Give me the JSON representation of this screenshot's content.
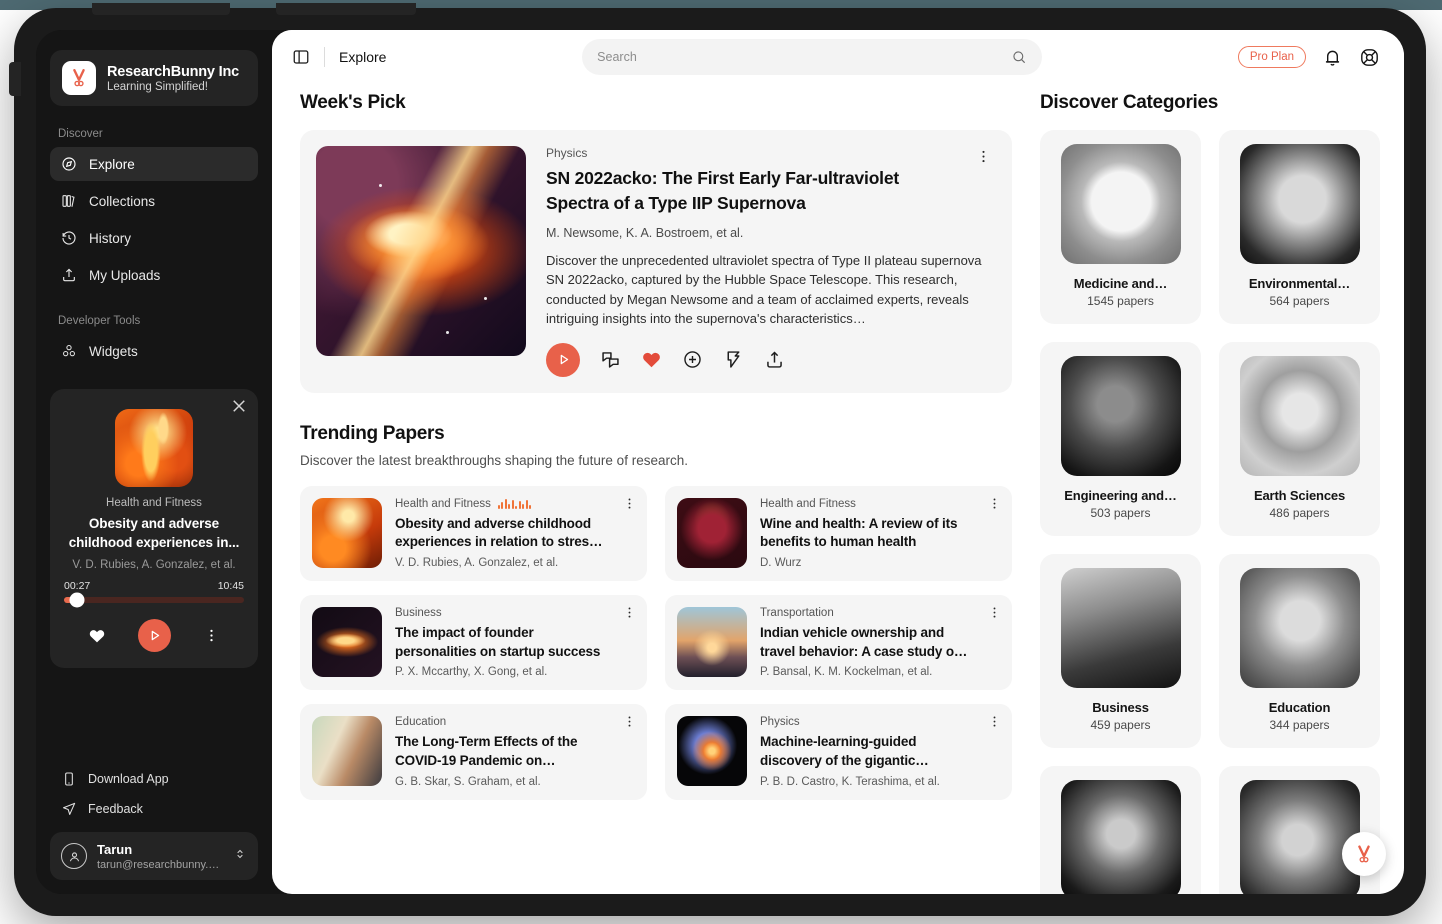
{
  "brand": {
    "name": "ResearchBunny Inc",
    "tagline": "Learning Simplified!",
    "logo_icon": "bunny-logo-icon"
  },
  "sidebar": {
    "groups": [
      {
        "label": "Discover",
        "items": [
          {
            "label": "Explore",
            "icon": "compass-icon",
            "active": true
          },
          {
            "label": "Collections",
            "icon": "books-icon",
            "active": false
          },
          {
            "label": "History",
            "icon": "history-clock-icon",
            "active": false
          },
          {
            "label": "My Uploads",
            "icon": "upload-icon",
            "active": false
          }
        ]
      },
      {
        "label": "Developer Tools",
        "items": [
          {
            "label": "Widgets",
            "icon": "widgets-icon",
            "active": false
          }
        ]
      }
    ],
    "player": {
      "category": "Health and Fitness",
      "title": "Obesity and adverse childhood experiences in...",
      "authors": "V. D. Rubies, A. Gonzalez, et al.",
      "current_time": "00:27",
      "total_time": "10:45",
      "progress_percent": 7,
      "close_icon": "close-icon",
      "like_icon": "heart-icon",
      "play_icon": "play-icon",
      "more_icon": "more-vertical-icon",
      "accent_color": "#e8614a"
    },
    "links": [
      {
        "label": "Download App",
        "icon": "phone-icon"
      },
      {
        "label": "Feedback",
        "icon": "send-icon"
      }
    ],
    "account": {
      "name": "Tarun",
      "email": "tarun@researchbunny.com",
      "avatar_icon": "user-avatar-icon",
      "chevron_icon": "chevron-up-down-icon"
    }
  },
  "topbar": {
    "toggle_icon": "sidebar-toggle-icon",
    "title": "Explore",
    "search_placeholder": "Search",
    "search_value": "",
    "search_icon": "search-icon",
    "plan_badge": "Pro Plan",
    "bell_icon": "bell-icon",
    "help_icon": "lifebuoy-icon",
    "accent_color": "#e8614a"
  },
  "weeks_pick": {
    "section_title": "Week's Pick",
    "category": "Physics",
    "title": "SN 2022acko: The First Early Far-ultraviolet Spectra of a Type IIP Supernova",
    "authors": "M. Newsome, K. A. Bostroem, et al.",
    "description": "Discover the unprecedented ultraviolet spectra of Type II plateau supernova SN 2022acko, captured by the Hubble Space Telescope. This research, conducted by Megan Newsome and a team of acclaimed experts, reveals intriguing insights into the supernova's characteristics…",
    "more_icon": "more-vertical-icon",
    "actions": [
      {
        "icon": "play-icon",
        "name": "play-button"
      },
      {
        "icon": "chat-icon",
        "name": "comment-button"
      },
      {
        "icon": "heart-filled-icon",
        "name": "like-button"
      },
      {
        "icon": "plus-circle-icon",
        "name": "add-button"
      },
      {
        "icon": "bookmark-flag-icon",
        "name": "save-button"
      },
      {
        "icon": "share-icon",
        "name": "share-button"
      }
    ]
  },
  "trending": {
    "section_title": "Trending Papers",
    "subtitle": "Discover the latest breakthroughs shaping the future of research.",
    "papers": [
      {
        "category": "Health and Fitness",
        "title": "Obesity and adverse childhood experiences in relation to stres…",
        "authors": "V. D. Rubies, A. Gonzalez, et al.",
        "playing": true,
        "art": "art-obesity"
      },
      {
        "category": "Health and Fitness",
        "title": "Wine and health: A review of its benefits to human health",
        "authors": "D. Wurz",
        "playing": false,
        "art": "art-wine"
      },
      {
        "category": "Business",
        "title": "The impact of founder personalities on startup success",
        "authors": "P. X. Mccarthy, X. Gong, et al.",
        "playing": false,
        "art": "art-founder"
      },
      {
        "category": "Transportation",
        "title": "Indian vehicle ownership and travel behavior: A case study o…",
        "authors": "P. Bansal, K. M. Kockelman, et al.",
        "playing": false,
        "art": "art-vehicle"
      },
      {
        "category": "Education",
        "title": "The Long-Term Effects of the COVID-19 Pandemic on…",
        "authors": "G. B. Skar, S. Graham, et al.",
        "playing": false,
        "art": "art-covid"
      },
      {
        "category": "Physics",
        "title": "Machine-learning-guided discovery of the gigantic…",
        "authors": "P. B. D. Castro, K. Terashima, et al.",
        "playing": false,
        "art": "art-ml"
      }
    ]
  },
  "categories": {
    "section_title": "Discover Categories",
    "items": [
      {
        "name": "Medicine and…",
        "count": "1545 papers",
        "art": "g-med"
      },
      {
        "name": "Environmental…",
        "count": "564 papers",
        "art": "g-env"
      },
      {
        "name": "Engineering and…",
        "count": "503 papers",
        "art": "g-eng"
      },
      {
        "name": "Earth Sciences",
        "count": "486 papers",
        "art": "g-earth"
      },
      {
        "name": "Business",
        "count": "459 papers",
        "art": "g-bus"
      },
      {
        "name": "Education",
        "count": "344 papers",
        "art": "g-edu"
      },
      {
        "name": "",
        "count": "",
        "art": "g-7"
      },
      {
        "name": "",
        "count": "",
        "art": "g-8"
      }
    ]
  },
  "fab": {
    "icon": "bunny-logo-icon"
  },
  "decor": {
    "teal_color": "#4e6a72"
  }
}
